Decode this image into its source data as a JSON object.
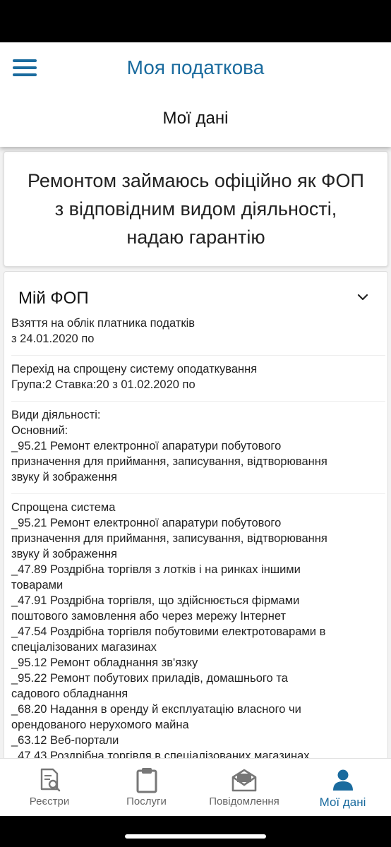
{
  "header": {
    "app_title": "Моя податкова",
    "page_title": "Мої дані"
  },
  "banner": {
    "lines": [
      "Ремонтом займаюсь офіційно як ФОП",
      "з відповідним видом діяльності,",
      "надаю гарантію"
    ]
  },
  "card": {
    "title": "Мій ФОП",
    "registration": [
      "Взяття на облік платника податків",
      "з 24.01.2020 по"
    ],
    "simplified": [
      "Перехід на спрощену систему оподаткування",
      "Група:2 Ставка:20 з 01.02.2020 по"
    ],
    "activities_main": [
      "Види діяльності:",
      "Основний:",
      "_95.21 Ремонт електронної апаратури побутового",
      "призначення для приймання, записування, відтворювання",
      "звуку й зображення"
    ],
    "activities_simplified": [
      "Спрощена система",
      "_95.21 Ремонт електронної апаратури побутового",
      "призначення для приймання, записування, відтворювання",
      "звуку й зображення",
      "_47.89 Роздрібна торгівля з лотків і на ринках іншими",
      "товарами",
      "_47.91 Роздрібна торгівля, що здійснюється фірмами",
      "поштового замовлення або через мережу Інтернет",
      "_47.54 Роздрібна торгівля побутовими електротоварами в",
      "спеціалізованих магазинах",
      "_95.12 Ремонт обладнання зв'язку",
      "_95.22 Ремонт побутових приладів, домашнього та",
      "садового обладнання",
      "_68.20 Надання в оренду й експлуатацію  власного чи",
      "орендованого нерухомого майна",
      "_63.12 Веб-портали",
      "_47.43 Роздрібна торгівля в спеціалізованих магазинах"
    ]
  },
  "tabs": [
    {
      "label": "Реєстри",
      "icon": "registry-search-icon"
    },
    {
      "label": "Послуги",
      "icon": "clipboard-icon"
    },
    {
      "label": "Повідомлення",
      "icon": "envelope-icon"
    },
    {
      "label": "Мої дані",
      "icon": "user-icon"
    }
  ],
  "colors": {
    "accent": "#1a6b9e",
    "inactive": "#666666"
  }
}
